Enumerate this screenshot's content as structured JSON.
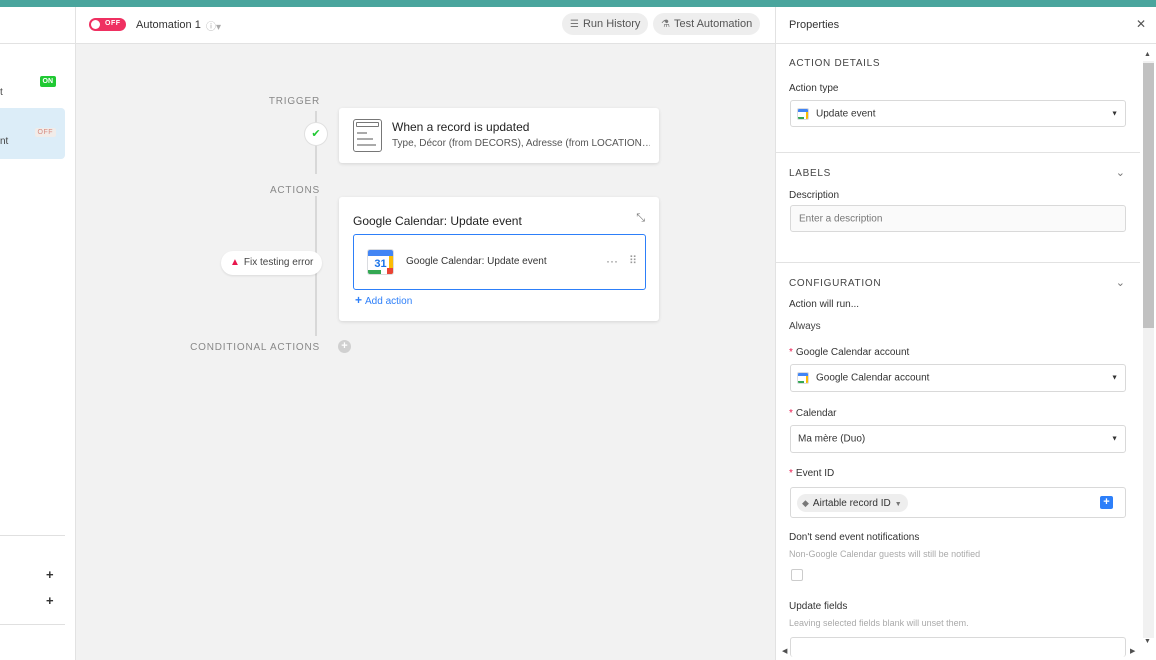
{
  "sidebar": {
    "item1": {
      "label": "t",
      "badge": "ON"
    },
    "item2": {
      "label": "nt",
      "badge": "OFF"
    },
    "add1": "+",
    "add2": "+"
  },
  "toolbar": {
    "toggle_label": "OFF",
    "automation_name": "Automation 1",
    "run_history": "Run History",
    "test_automation": "Test Automation"
  },
  "canvas": {
    "trigger_label": "TRIGGER",
    "actions_label": "ACTIONS",
    "conditional_label": "CONDITIONAL ACTIONS",
    "trigger_card": {
      "title": "When a record is updated",
      "subtitle": "Type, Décor (from DÉCORS), Adresse (from LOCATION…"
    },
    "action_card": {
      "title": "Google Calendar: Update event",
      "inner_label": "Google Calendar: Update event",
      "calendar_day": "31",
      "add_action": "Add action"
    },
    "fix_error": "Fix testing error"
  },
  "properties": {
    "title": "Properties",
    "action_details": {
      "section": "ACTION DETAILS",
      "action_type_label": "Action type",
      "action_type_value": "Update event"
    },
    "labels": {
      "section": "LABELS",
      "description_label": "Description",
      "description_placeholder": "Enter a description"
    },
    "configuration": {
      "section": "CONFIGURATION",
      "run_label": "Action will run...",
      "run_value": "Always",
      "account_label": "Google Calendar account",
      "account_value": "Google Calendar account",
      "calendar_label": "Calendar",
      "calendar_value": "Ma mère (Duo)",
      "event_id_label": "Event ID",
      "event_id_token": "Airtable record ID",
      "notifications_label": "Don't send event notifications",
      "notifications_help": "Non-Google Calendar guests will still be notified",
      "update_fields_label": "Update fields",
      "update_fields_help": "Leaving selected fields blank will unset them."
    }
  },
  "colors": {
    "accent": "#2d7ff9",
    "toggle_off": "#ef3061",
    "on_badge": "#20c933",
    "top_strip": "#4aa59d"
  }
}
